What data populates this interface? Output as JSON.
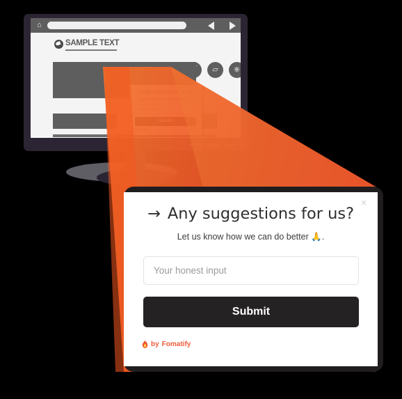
{
  "colors": {
    "background": "#000000",
    "monitor_bezel": "#2b2533",
    "beam_start": "#f2722c",
    "beam_end": "#ee3b24",
    "modal_backdrop": "#201d1e",
    "submit_bg": "#242223",
    "brand_orange": "#f05a3c",
    "screen_bg": "#f4f4f4",
    "chrome_bar": "#5e5e5e"
  },
  "browser": {
    "home_icon": "home-icon",
    "url_value": "",
    "url_placeholder": "",
    "back_icon": "arrow-left-icon",
    "forward_icon": "arrow-right-icon"
  },
  "site": {
    "logo_text": "SAMPLE TEXT",
    "logo_icon": "globe-icon",
    "nav_icons": [
      {
        "name": "home-icon",
        "glyph": "⌂"
      },
      {
        "name": "shopping-cart-icon",
        "glyph": "⬚"
      },
      {
        "name": "folder-icon",
        "glyph": "▱"
      },
      {
        "name": "car-icon",
        "glyph": "▬"
      }
    ]
  },
  "modal": {
    "close_label": "×",
    "arrow": "→",
    "title": "Any suggestions for us?",
    "subtitle": "Let us know how we can do better 🙏.",
    "input_value": "",
    "input_placeholder": "Your honest input",
    "submit_label": "Submit",
    "brand_prefix": "by",
    "brand_name": "Fomatify",
    "brand_icon": "flame-icon"
  },
  "mini_modal": {
    "close_label": "×",
    "title": "→  Any suggestions for us?",
    "subtitle": "Let us know how we can do better 🙏",
    "input_placeholder": "Your honest input",
    "submit_label": "Submit",
    "brand": "by Fomatify"
  }
}
